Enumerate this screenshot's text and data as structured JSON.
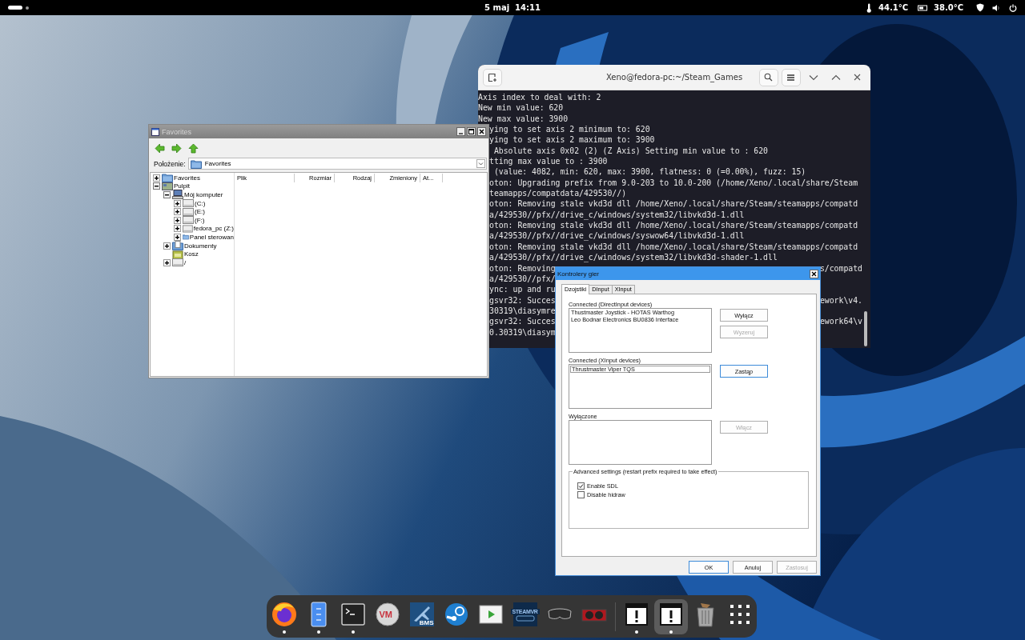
{
  "top_bar": {
    "clock": "5 maj  14:11",
    "readings": [
      {
        "kind": "thermometer",
        "text": "44.1°C"
      },
      {
        "kind": "card",
        "text": "38.0°C"
      }
    ],
    "status_icons": [
      {
        "kind": "shield"
      },
      {
        "kind": "speaker"
      },
      {
        "kind": "power"
      }
    ]
  },
  "file_window": {
    "title": "Favorites",
    "location_label": "Położenie:",
    "location": "Favorites",
    "tree": [
      {
        "label": "Favorites",
        "kind": "folder",
        "expanded": false
      },
      {
        "label": "Pulpit",
        "kind": "desktop",
        "expanded": true,
        "children": [
          {
            "label": "Mój komputer",
            "kind": "computer",
            "expanded": true,
            "children": [
              {
                "label": "(C:)",
                "kind": "drive",
                "expanded": false
              },
              {
                "label": "(E:)",
                "kind": "drive",
                "expanded": false
              },
              {
                "label": "(F:)",
                "kind": "drive",
                "expanded": false
              },
              {
                "label": "fedora_pc (Z:)",
                "kind": "drive",
                "expanded": false
              },
              {
                "label": "Panel sterowan",
                "kind": "folder",
                "expanded": false
              }
            ]
          },
          {
            "label": "Dokumenty",
            "kind": "documents",
            "expanded": false
          },
          {
            "label": "Kosz",
            "kind": "trash"
          },
          {
            "label": "/",
            "kind": "drive",
            "expanded": false
          }
        ]
      }
    ],
    "columns": [
      "Plik",
      "Rozmiar",
      "Rodzaj",
      "Zmieniony",
      "At..."
    ]
  },
  "terminal": {
    "title": "Xeno@fedora-pc:~/Steam_Games",
    "lines": [
      "Axis index to deal with: 2",
      "New min value: 620",
      "New max value: 3900",
      "ying to set axis 2 minimum to: 620",
      "ying to set axis 2 maximum to: 3900",
      " Absolute axis 0x02 (2) (Z Axis) Setting min value to : 620",
      "tting max value to : 3900",
      " (value: 4082, min: 620, max: 3900, flatness: 0 (=0.00%), fuzz: 15)",
      "oton: Upgrading prefix from 9.0-203 to 10.0-200 (/home/Xeno/.local/share/Steam",
      "teamapps/compatdata/429530//)",
      "oton: Removing stale vkd3d dll /home/Xeno/.local/share/Steam/steamapps/compatd",
      "a/429530//pfx//drive_c/windows/system32/libvkd3d-1.dll",
      "oton: Removing stale vkd3d dll /home/Xeno/.local/share/Steam/steamapps/compatd",
      "a/429530//pfx//drive_c/windows/syswow64/libvkd3d-1.dll",
      "oton: Removing stale vkd3d dll /home/Xeno/.local/share/Steam/steamapps/compatd",
      "a/429530//pfx//drive_c/windows/system32/libvkd3d-shader-1.dll",
      {
        "left": "oton: Removing",
        "right": "s/compatd"
      },
      {
        "left": "a/429530//pfx/"
      },
      {
        "left": "ync: up and ru"
      },
      {
        "left": "gsvr32: Succes",
        "right": "ework\\v4."
      },
      {
        "left": "30319\\diasymre"
      },
      {
        "left": "gsvr32: Succes",
        "right": "ework64\\v"
      },
      {
        "left": "0.30319\\diasym"
      }
    ]
  },
  "dialog": {
    "title": "Kontrolery gier",
    "tabs": [
      {
        "label": "Dzojstiki",
        "selected": true
      },
      {
        "label": "DInput",
        "selected": false
      },
      {
        "label": "XInput",
        "selected": false
      }
    ],
    "sections": [
      {
        "label": "Connected (DirectInput devices)",
        "devices": [
          {
            "name": "Thustmaster Joystick - HOTAS Warthog",
            "selected": false
          },
          {
            "name": "Leo Bodnar Electronics BU0836 Interface",
            "selected": false
          }
        ],
        "buttons": [
          {
            "label": "Wyłącz",
            "disabled": false,
            "focused": false
          },
          {
            "label": "Wyzeruj",
            "disabled": true,
            "focused": false
          }
        ]
      },
      {
        "label": "Connected (XInput devices)",
        "devices": [
          {
            "name": "Thrustmaster Viper TQS",
            "selected": true
          }
        ],
        "buttons": [
          {
            "label": "Zastąp",
            "disabled": false,
            "focused": true
          }
        ]
      },
      {
        "label": "Wyłączone",
        "buttons": [
          {
            "label": "Włącz",
            "disabled": true,
            "focused": false
          }
        ]
      }
    ],
    "advanced": {
      "legend": "Advanced settings (restart prefix required to take effect)",
      "options": [
        {
          "label": "Enable SDL",
          "checked": true
        },
        {
          "label": "Disable hidraw",
          "checked": false
        }
      ]
    },
    "footer_buttons": [
      {
        "label": "OK",
        "disabled": false,
        "focused": true
      },
      {
        "label": "Anuluj",
        "disabled": false,
        "focused": false
      },
      {
        "label": "Zastosuj",
        "disabled": true,
        "focused": false
      }
    ]
  },
  "dock": {
    "groups": [
      [
        {
          "kind": "browser",
          "running": true,
          "selected": false
        },
        {
          "kind": "files",
          "running": true,
          "selected": false
        },
        {
          "kind": "terminal",
          "running": true,
          "selected": false
        },
        {
          "kind": "vm",
          "label": "VM",
          "running": false,
          "selected": false
        },
        {
          "kind": "jet",
          "label": "BMS",
          "running": false,
          "selected": false
        },
        {
          "kind": "steam",
          "running": false,
          "selected": false
        },
        {
          "kind": "player",
          "running": false,
          "selected": false
        },
        {
          "kind": "vr",
          "label": "STEAMVR",
          "running": false,
          "selected": false
        },
        {
          "kind": "headset",
          "running": false,
          "selected": false
        },
        {
          "kind": "gpu",
          "running": false,
          "selected": false
        }
      ],
      [
        {
          "kind": "alert",
          "running": true,
          "selected": false
        },
        {
          "kind": "alert",
          "running": true,
          "selected": true
        },
        {
          "kind": "trash",
          "running": false,
          "selected": false
        },
        {
          "kind": "apps",
          "running": false,
          "selected": false
        }
      ]
    ]
  }
}
